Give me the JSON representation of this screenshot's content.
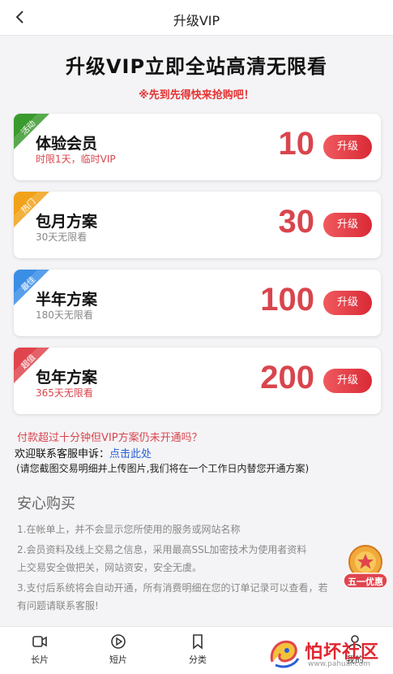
{
  "nav": {
    "title": "升级VIP"
  },
  "headline": "升级VIP立即全站高清无限看",
  "subline": "※先到先得快来抢购吧！",
  "plans": [
    {
      "ribbon": "活动",
      "ribbon_color": "#3b9a2e",
      "name": "体验会员",
      "desc": "时限1天，临时VIP",
      "desc_color": "#d9454d",
      "price": "10",
      "button": "升级"
    },
    {
      "ribbon": "热门",
      "ribbon_color": "#f0a21a",
      "name": "包月方案",
      "desc": "30天无限看",
      "desc_color": "#888888",
      "price": "30",
      "button": "升级"
    },
    {
      "ribbon": "最佳",
      "ribbon_color": "#3a8ee6",
      "name": "半年方案",
      "desc": "180天无限看",
      "desc_color": "#888888",
      "price": "100",
      "button": "升级"
    },
    {
      "ribbon": "超值",
      "ribbon_color": "#e0454e",
      "name": "包年方案",
      "desc": "365天无限看",
      "desc_color": "#d9454d",
      "price": "200",
      "button": "升级"
    }
  ],
  "notice": "付款超过十分钟但VIP方案仍未开通吗？",
  "contact": {
    "prefix": "欢迎联系客服申诉：",
    "link": "点击此处"
  },
  "hint": "(请您截图交易明细并上传图片,我们将在一个工作日内替您开通方案)",
  "security": {
    "title": "安心购买",
    "lines": [
      "1.在帐单上，并不会显示您所使用的服务或网站名称",
      "2.会员资料及线上交易之信息，采用最高SSL加密技术为使用者资料",
      "上交易安全做把关，网站资安，安全无虞。",
      "3.支付后系统将会自动开通，所有消费明细在您的订单记录可以查看，若",
      "有问题请联系客服!"
    ]
  },
  "badge": {
    "text": "五一优惠"
  },
  "tabs": [
    {
      "label": "长片",
      "icon": "video-icon"
    },
    {
      "label": "短片",
      "icon": "play-circle-icon"
    },
    {
      "label": "分类",
      "icon": "bookmark-icon"
    },
    {
      "label": "我的",
      "icon": "user-icon"
    }
  ],
  "watermark": {
    "title": "怕坏社区",
    "url": "www.pahuai.com"
  },
  "colors": {
    "accent": "#d9454d",
    "link": "#2b5fd9"
  }
}
